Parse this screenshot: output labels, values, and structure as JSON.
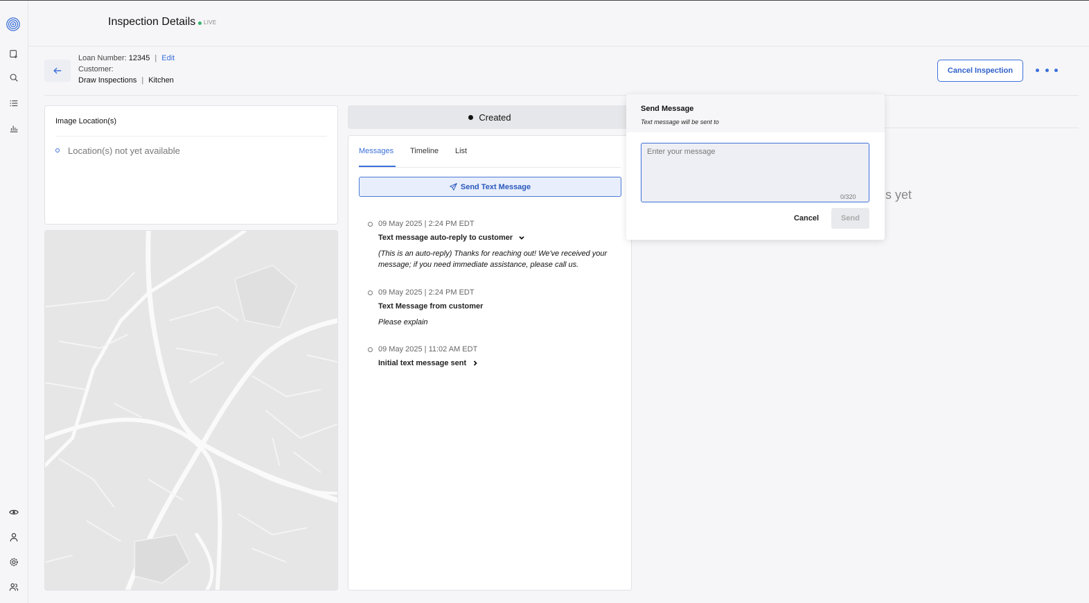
{
  "header": {
    "title": "Inspection Details",
    "live_badge": "LIVE"
  },
  "loan": {
    "loan_number_label": "Loan Number:",
    "loan_number": "12345",
    "edit_label": "Edit",
    "customer_label": "Customer:",
    "inspection_type": "Draw Inspections",
    "room": "Kitchen"
  },
  "actions": {
    "cancel_inspection": "Cancel Inspection"
  },
  "image_location": {
    "title": "Image Location(s)",
    "empty_text": "Location(s) not yet available"
  },
  "status": {
    "label": "Created"
  },
  "messages_panel": {
    "tabs": [
      {
        "label": "Messages",
        "active": true
      },
      {
        "label": "Timeline",
        "active": false
      },
      {
        "label": "List",
        "active": false
      }
    ],
    "send_button": "Send Text Message",
    "entries": [
      {
        "date": "09 May 2025 | 2:24 PM EDT",
        "title": "Text message auto-reply to customer",
        "body": "(This is an auto-reply) Thanks for reaching out! We've received your message; if you need immediate assistance, please call us."
      },
      {
        "date": "09 May 2025 | 2:24 PM EDT",
        "title": "Text Message from customer",
        "body": "Please explain"
      },
      {
        "date": "09 May 2025 | 11:02 AM EDT",
        "title": "Initial text message sent",
        "body": ""
      }
    ]
  },
  "background_text": "s yet",
  "send_message_popover": {
    "title": "Send Message",
    "subtitle": "Text message will be sent to",
    "placeholder": "Enter your message",
    "char_count": "0/320",
    "cancel_label": "Cancel",
    "send_label": "Send"
  },
  "sidebar": {
    "icons": [
      "logo-icon",
      "new-inspection-icon",
      "search-icon",
      "list-icon",
      "chart-icon",
      "eye-icon",
      "user-icon",
      "settings-icon",
      "users-icon"
    ]
  },
  "colors": {
    "accent": "#3b6fd9",
    "live": "#33b36b",
    "background": "#f6f6f8"
  }
}
